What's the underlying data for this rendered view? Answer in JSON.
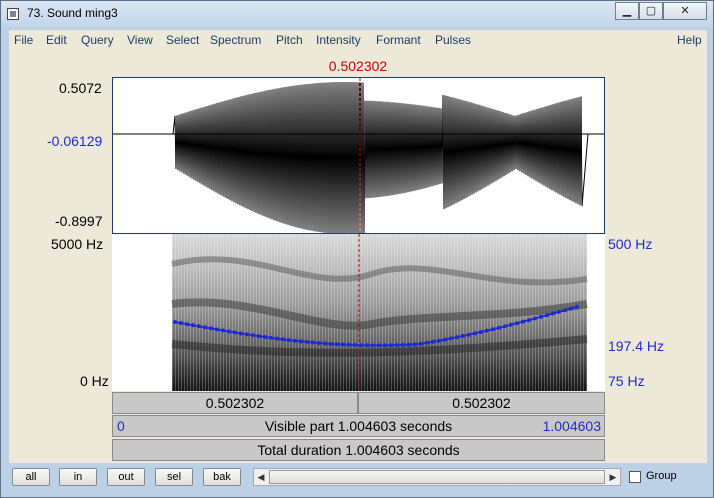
{
  "window": {
    "title": "73. Sound ming3"
  },
  "menu": [
    "File",
    "Edit",
    "Query",
    "View",
    "Select",
    "Spectrum",
    "Pitch",
    "Intensity",
    "Formant",
    "Pulses"
  ],
  "menu_help": "Help",
  "cursor_time": "0.502302",
  "waveform": {
    "max_label": "0.5072",
    "cursor_value_label": "-0.06129",
    "min_label": "-0.8997"
  },
  "spectrogram": {
    "top_freq_label": "5000 Hz",
    "bottom_freq_label": "0 Hz"
  },
  "pitch_axis": {
    "top_label": "500 Hz",
    "cursor_label": "197.4 Hz",
    "bottom_label": "75 Hz"
  },
  "time_bars": {
    "left_segment": "0.502302",
    "right_segment": "0.502302",
    "visible_start": "0",
    "visible_label": "Visible part 1.004603 seconds",
    "visible_end": "1.004603",
    "total_label": "Total duration 1.004603 seconds"
  },
  "buttons": {
    "all": "all",
    "in": "in",
    "out": "out",
    "sel": "sel",
    "bak": "bak"
  },
  "group_label": "Group",
  "colors": {
    "cursor": "#c40000",
    "pitch": "#1f2bcf",
    "label_blue": "#1f2bcf"
  }
}
